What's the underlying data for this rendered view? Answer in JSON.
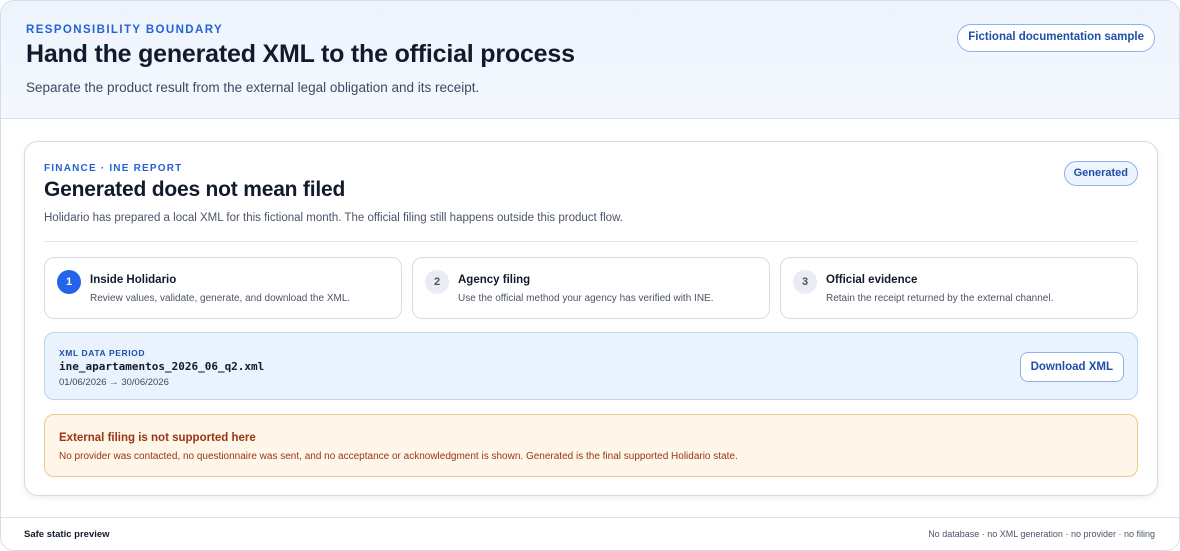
{
  "header": {
    "eyebrow": "RESPONSIBILITY BOUNDARY",
    "title": "Hand the generated XML to the official process",
    "subtitle": "Separate the product result from the external legal obligation and its receipt.",
    "sample_badge": "Fictional documentation sample"
  },
  "card": {
    "eyebrow": "FINANCE · INE REPORT",
    "title": "Generated does not mean filed",
    "description": "Holidario has prepared a local XML for this fictional month. The official filing still happens outside this product flow.",
    "status_badge": "Generated",
    "steps": [
      {
        "number": "1",
        "title": "Inside Holidario",
        "text": "Review values, validate, generate, and download the XML.",
        "active": true
      },
      {
        "number": "2",
        "title": "Agency filing",
        "text": "Use the official method your agency has verified with INE.",
        "active": false
      },
      {
        "number": "3",
        "title": "Official evidence",
        "text": "Retain the receipt returned by the external channel.",
        "active": false
      }
    ],
    "xml": {
      "label": "XML DATA PERIOD",
      "filename": "ine_apartamentos_2026_06_q2.xml",
      "date_range": "01/06/2026 → 30/06/2026",
      "download_label": "Download XML"
    },
    "warning": {
      "title": "External filing is not supported here",
      "text": "No provider was contacted, no questionnaire was sent, and no acceptance or acknowledgment is shown. Generated is the final supported Holidario state."
    }
  },
  "footer": {
    "left": "Safe static preview",
    "right": "No database · no XML generation · no provider · no filing"
  },
  "colors": {
    "accent": "#2563eb",
    "accent_text": "#1f4fa8",
    "warning_text": "#9a3412",
    "warning_bg": "#fff6ea"
  }
}
